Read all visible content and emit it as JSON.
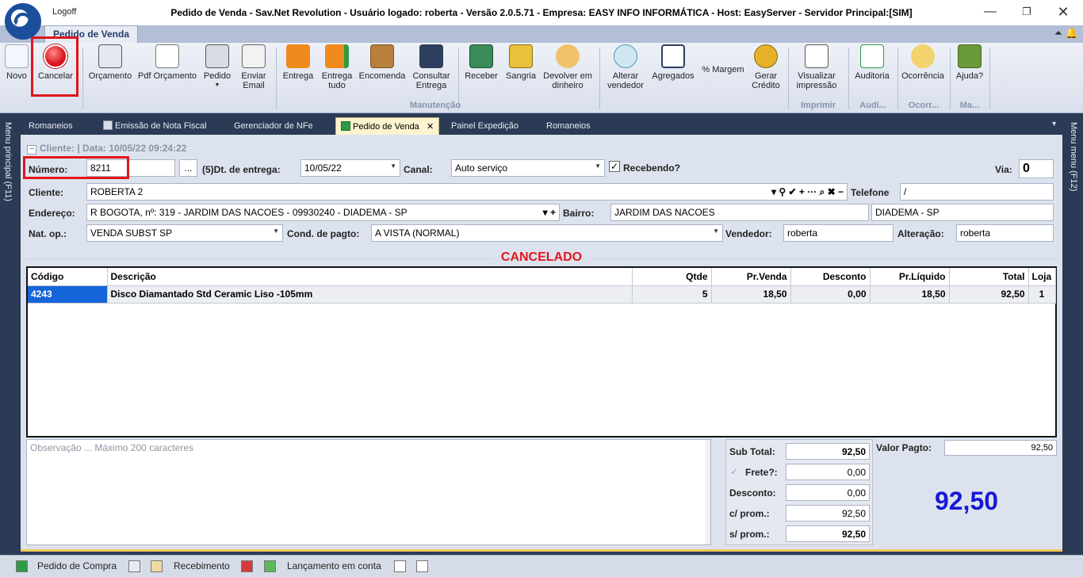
{
  "window": {
    "title": "Pedido de Venda - Sav.Net Revolution - Usuário logado: roberta - Versão 2.0.5.71 - Empresa: EASY INFO INFORMÁTICA - Host: EasyServer - Servidor Principal:[SIM]",
    "logoff": "Logoff",
    "minimize": "—",
    "maximize": "❐",
    "close": "✕"
  },
  "ribbon": {
    "tab": "Pedido de Venda",
    "tabrow_icons": "⏶ 🔔",
    "buttons": [
      {
        "label": "Novo",
        "icon": "new-document-icon"
      },
      {
        "label": "Cancelar",
        "icon": "cancel-x-icon"
      },
      {
        "label": "Orçamento",
        "icon": "floppy-icon"
      },
      {
        "label": "Pdf Orçamento",
        "icon": "pdf-icon"
      },
      {
        "label": "Pedido",
        "icon": "printer-icon"
      },
      {
        "label": "Enviar",
        "label2": "Email",
        "icon": "envelope-icon"
      },
      {
        "label": "Entrega",
        "icon": "truck-icon"
      },
      {
        "label": "Entrega",
        "label2": "tudo",
        "icon": "truck-plus-icon"
      },
      {
        "label": "Encomenda",
        "icon": "box-icon"
      },
      {
        "label": "Consultar",
        "label2": "Entrega",
        "icon": "truck-search-icon"
      },
      {
        "label": "Receber",
        "icon": "safe-icon"
      },
      {
        "label": "Sangria",
        "icon": "cash-register-icon"
      },
      {
        "label": "Devolver em",
        "label2": "dinheiro",
        "icon": "hand-money-icon"
      },
      {
        "label": "Alterar",
        "label2": "vendedor",
        "icon": "users-swap-icon"
      },
      {
        "label": "Agregados",
        "icon": "aggregate-icon"
      },
      {
        "label": "% Margem",
        "icon": ""
      },
      {
        "label": "Gerar",
        "label2": "Crédito",
        "icon": "coins-icon"
      },
      {
        "label": "Visualizar",
        "label2": "impressão",
        "icon": "print-preview-icon"
      },
      {
        "label": "Auditoria",
        "icon": "audit-icon"
      },
      {
        "label": "Ocorrência",
        "icon": "warning-user-icon"
      },
      {
        "label": "Ajuda?",
        "icon": "help-book-icon"
      }
    ],
    "groups": [
      "Manutenção",
      "Imprimir",
      "Audi...",
      "Ocorr...",
      "Ma..."
    ]
  },
  "sidebars": {
    "left": "Menu principal (F11)",
    "right": "Menu menu (F12)"
  },
  "doc_tabs": [
    "Romaneios",
    "Emissão de Nota Fiscal",
    "Gerenciador de NFe",
    "Pedido de Venda",
    "Painel Expedição",
    "Romaneios"
  ],
  "doc_tab_close": "✕",
  "form": {
    "legend_minus": "−",
    "legend": "Cliente:   | Data: 10/05/22 09:24:22",
    "numero_label": "Número:",
    "numero_value": "8211",
    "ellipsis": "...",
    "dt_entrega_label": "(5)Dt. de entrega:",
    "dt_entrega_value": "10/05/22",
    "canal_label": "Canal:",
    "canal_value": "Auto serviço",
    "recebendo_label": "Recebendo?",
    "via_label": "Via:",
    "via_value": "0",
    "cliente_label": "Cliente:",
    "cliente_value": "ROBERTA 2",
    "cliente_tools": "▾ ⚲ ✔ + ··· ⌕ ✖ −",
    "telefone_label": "Telefone",
    "telefone_value": "/",
    "endereco_label": "Endereço:",
    "endereco_value": "R BOGOTA, nº: 319 - JARDIM DAS NACOES - 09930240 - DIADEMA - SP",
    "endereco_tools": "▾ +",
    "bairro_label": "Bairro:",
    "bairro_value": "JARDIM DAS NACOES",
    "cidade_value": "DIADEMA - SP",
    "natop_label": "Nat. op.:",
    "natop_value": "VENDA SUBST SP",
    "cond_label": "Cond. de pagto:",
    "cond_value": "A VISTA (NORMAL)",
    "vendedor_label": "Vendedor:",
    "vendedor_value": "roberta",
    "alteracao_label": "Alteração:",
    "alteracao_value": "roberta"
  },
  "status_banner": "CANCELADO",
  "grid": {
    "headers": [
      "Código",
      "Descrição",
      "Qtde",
      "Pr.Venda",
      "Desconto",
      "Pr.Líquido",
      "Total",
      "Loja"
    ],
    "rows": [
      [
        "4243",
        "Disco Diamantado Std Ceramic Liso -105mm",
        "5",
        "18,50",
        "0,00",
        "18,50",
        "92,50",
        "1"
      ]
    ]
  },
  "observacao_placeholder": "Observação ... Máximo 200 caracteres",
  "totals": {
    "subtotal_label": "Sub Total:",
    "subtotal_value": "92,50",
    "frete_label": "Frete?:",
    "frete_value": "0,00",
    "desconto_label": "Desconto:",
    "desconto_value": "0,00",
    "cprom_label": "c/ prom.:",
    "cprom_value": "92,50",
    "sprom_label": "s/ prom.:",
    "sprom_value": "92,50"
  },
  "payment": {
    "label": "Valor Pagto:",
    "value": "92,50",
    "big_total": "92,50"
  },
  "statusbar": {
    "items": [
      "Pedido de Compra",
      "Recebimento",
      "Lançamento em conta"
    ]
  },
  "colors": {
    "accent_red": "#e2171d",
    "selection_blue": "#1565d8",
    "total_blue": "#1818d6",
    "dark_bg": "#2b3a55"
  }
}
